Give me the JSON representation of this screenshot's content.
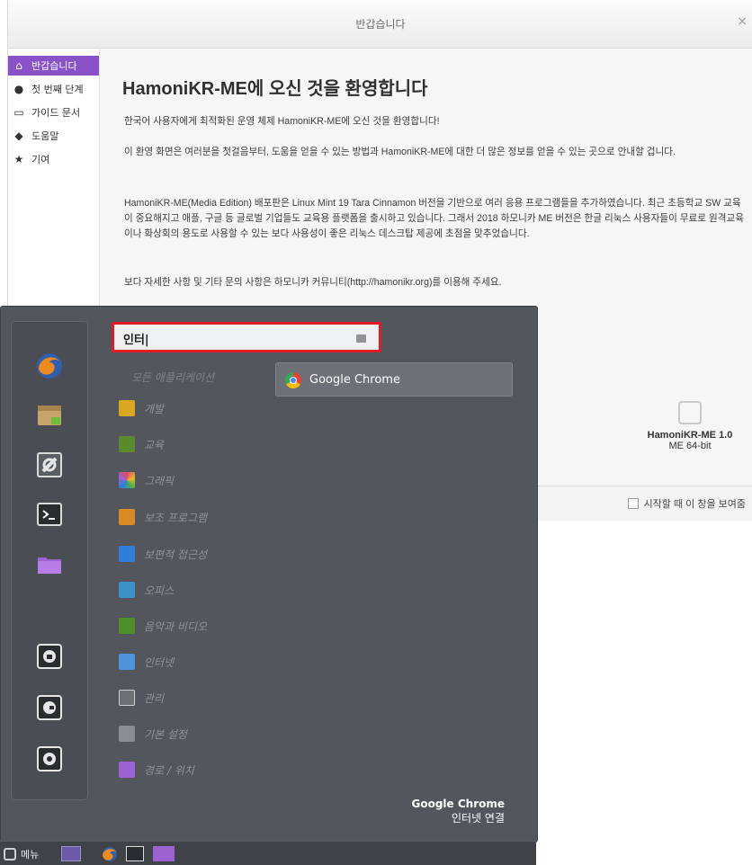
{
  "welcome": {
    "title": "반갑습니다",
    "close": "×",
    "sidebar": [
      {
        "label": "반갑습니다",
        "icon": "home-icon",
        "glyph": "⌂"
      },
      {
        "label": "첫 번째 단계",
        "icon": "info-icon",
        "glyph": "●"
      },
      {
        "label": "가이드 문서",
        "icon": "book-icon",
        "glyph": "▭"
      },
      {
        "label": "도움말",
        "icon": "chat-icon",
        "glyph": "◆"
      },
      {
        "label": "기여",
        "icon": "star-icon",
        "glyph": "★"
      }
    ],
    "heading": "HamoniKR-ME에 오신 것을 환영합니다",
    "paragraphs": [
      "한국어 사용자에게 최적화된 운영 체제 HamoniKR-ME에 오신 것을 환영합니다!",
      "이 환영 화면은 여러분을 첫걸음부터, 도움을 얻을 수 있는 방법과 HamoniKR-ME에 대한 더 많은 정보를 얻을 수 있는 곳으로 안내할 겁니다.",
      "HamoniKR-ME(Media Edition) 배포판은 Linux Mint 19 Tara Cinnamon 버전을 기반으로 여러 응용 프로그램들을 추가하였습니다. 최근 초등학교 SW 교육이 중요해지고 애플, 구글 등 글로벌 기업들도 교육용 플랫폼을 출시하고 있습니다. 그래서 2018 하모니카 ME 버전은 한글 리눅스 사용자들이 무료로 원격교육이나 화상회의 용도로 사용할 수 있는 보다 사용성이 좋은 리눅스 데스크탑 제공에 초점을 맞추었습니다.",
      "보다 자세한 사항 및 기타 문의 사항은 하모니카 커뮤니티(http://hamonikr.org)를 이용해 주세요."
    ],
    "brand_name": "HamoniKR-ME 1.0",
    "brand_build": "ME 64-bit",
    "show_on_startup": "시작할 때 이 창을 보여줌"
  },
  "menu": {
    "search_value": "인터|",
    "all_apps": "모든 애플리케이션",
    "categories": [
      {
        "label": "개발",
        "icon": "development-icon",
        "color": "#d9a81f"
      },
      {
        "label": "교육",
        "icon": "education-icon",
        "color": "#5a8a2e"
      },
      {
        "label": "그래픽",
        "icon": "graphics-icon",
        "color": "#e0456a"
      },
      {
        "label": "보조 프로그램",
        "icon": "accessories-icon",
        "color": "#d98a27"
      },
      {
        "label": "보편적 접근성",
        "icon": "accessibility-icon",
        "color": "#2f7ed8"
      },
      {
        "label": "오피스",
        "icon": "office-icon",
        "color": "#3a92c8"
      },
      {
        "label": "음악과 비디오",
        "icon": "multimedia-icon",
        "color": "#4e8f2a"
      },
      {
        "label": "인터넷",
        "icon": "internet-icon",
        "color": "#4d94d8"
      },
      {
        "label": "관리",
        "icon": "administration-icon",
        "color": "#6d7074"
      },
      {
        "label": "기본 설정",
        "icon": "preferences-icon",
        "color": "#8a8d91"
      },
      {
        "label": "경로 / 위치",
        "icon": "places-icon",
        "color": "#9b62d0"
      }
    ],
    "result_label": "Google Chrome",
    "desc_name": "Google Chrome",
    "desc_text": "인터넷 연결",
    "favorites": [
      "firefox-icon",
      "software-manager-icon",
      "system-settings-icon",
      "terminal-icon",
      "files-icon",
      "lock-screen-icon",
      "logout-icon",
      "shutdown-icon"
    ]
  },
  "taskbar": {
    "menu_label": "메뉴"
  }
}
